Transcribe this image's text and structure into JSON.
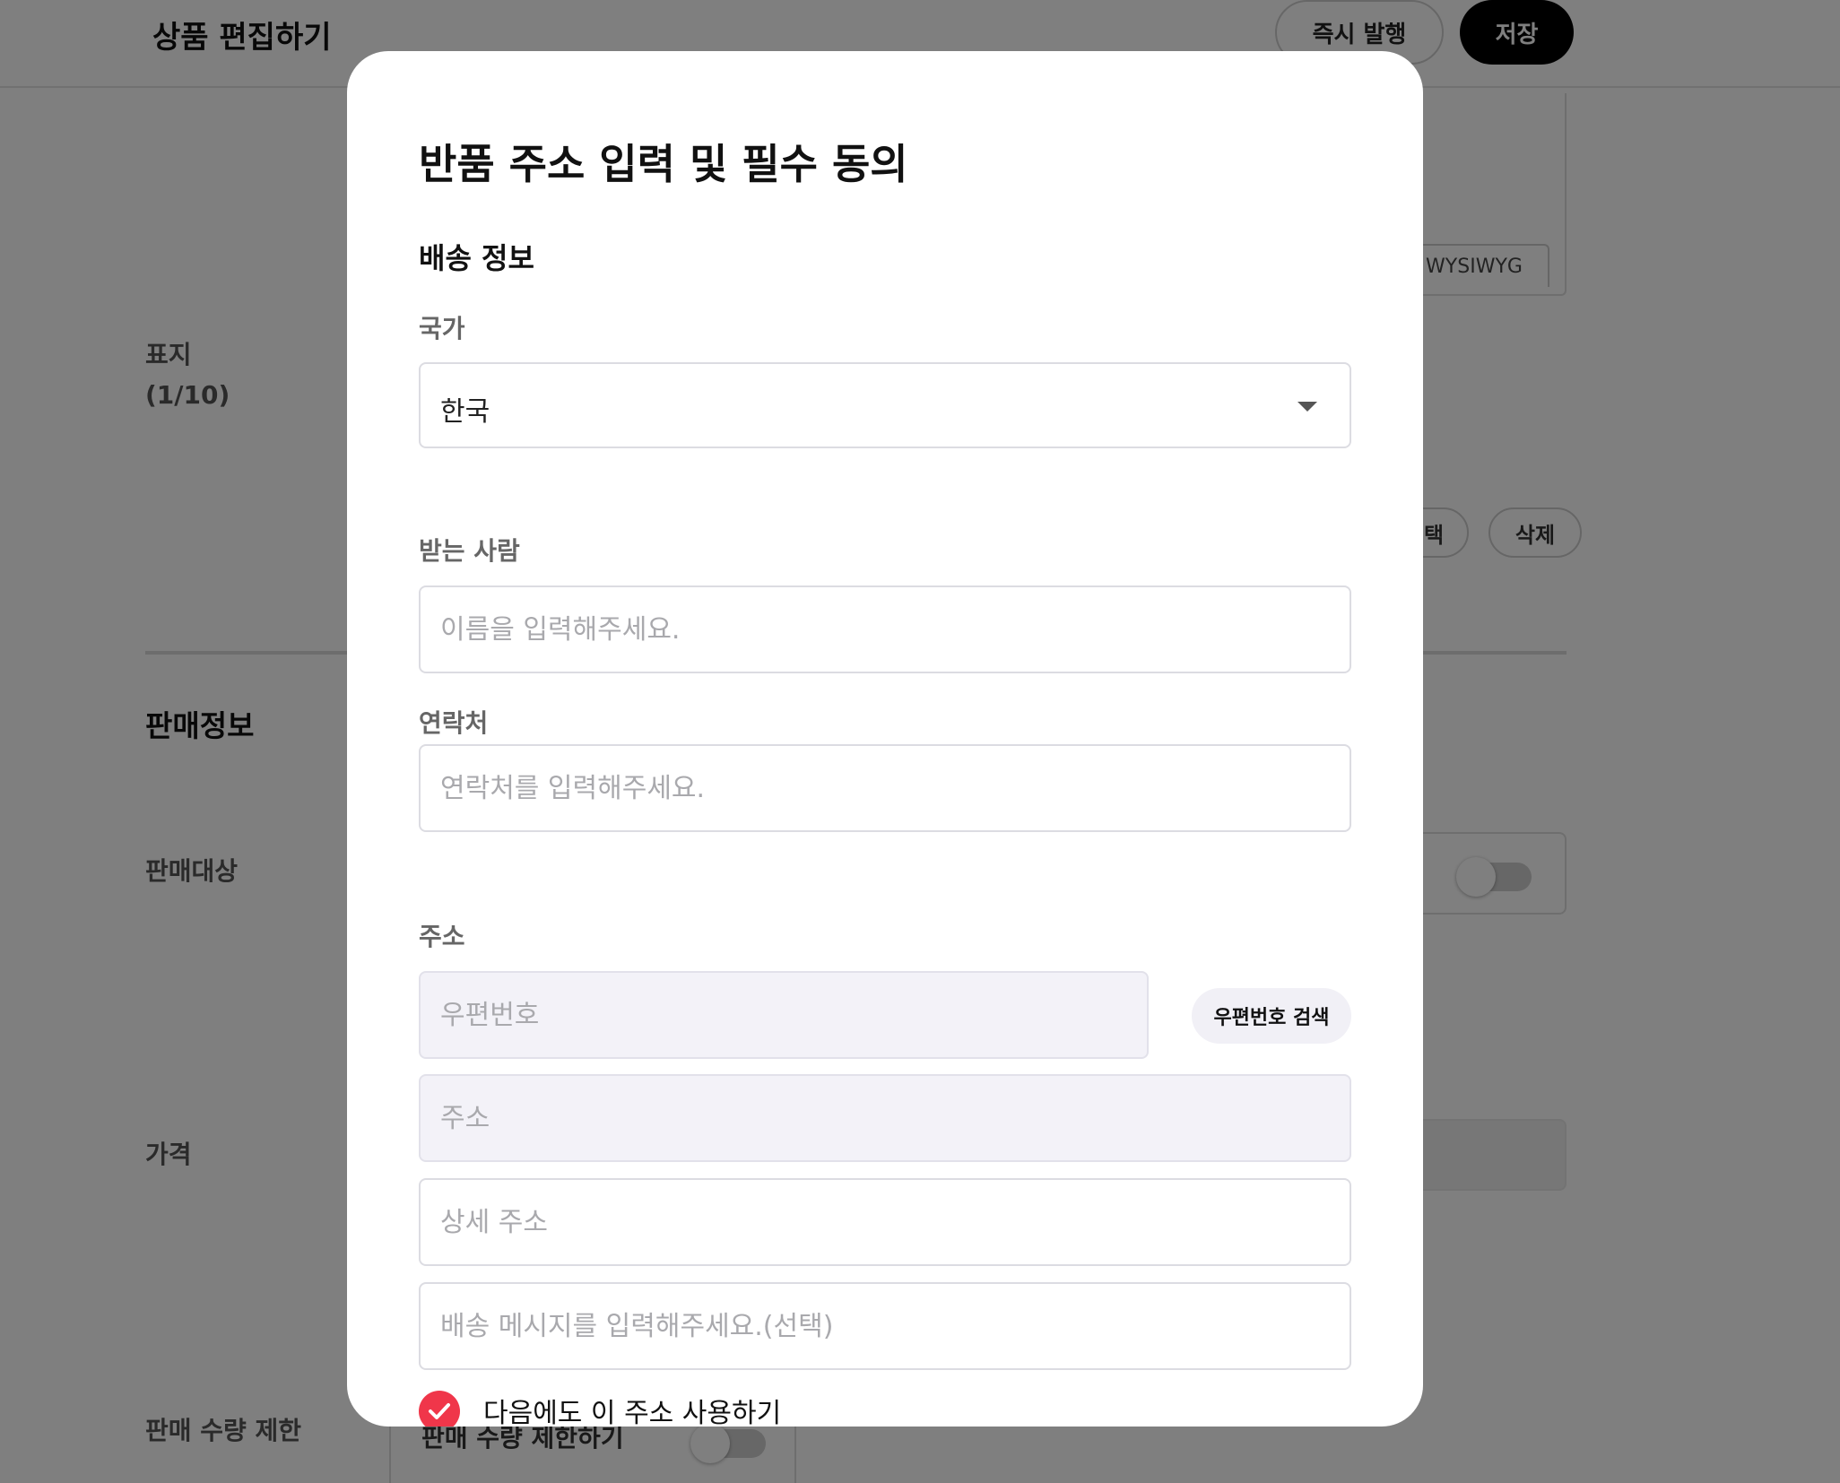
{
  "page": {
    "title": "상품 편집하기",
    "publish_now_label": "즉시 발행",
    "save_label": "저장",
    "editor_tab": "WYSIWYG",
    "cover_label": "표지",
    "cover_count": "(1/10)",
    "cover_select_label": "선택",
    "cover_delete_label": "삭제",
    "sales_section_title": "판매정보",
    "sales_target_label": "판매대상",
    "price_label": "가격",
    "quantity_limit_label": "판매 수량 제한",
    "quantity_limit_toggle_label": "판매 수량 제한하기"
  },
  "modal": {
    "title": "반품 주소 입력 및 필수 동의",
    "section_title": "배송 정보",
    "country": {
      "label": "국가",
      "value": "한국"
    },
    "recipient": {
      "label": "받는 사람",
      "placeholder": "이름을 입력해주세요."
    },
    "phone": {
      "label": "연락처",
      "placeholder": "연락처를 입력해주세요."
    },
    "address": {
      "label": "주소",
      "zip_placeholder": "우편번호",
      "zip_search_label": "우편번호 검색",
      "address_placeholder": "주소",
      "detail_placeholder": "상세 주소",
      "message_placeholder": "배송 메시지를 입력해주세요.(선택)"
    },
    "save_address": {
      "label": "다음에도 이 주소 사용하기",
      "checked": true
    }
  },
  "colors": {
    "accent_red": "#f0364a",
    "primary_black": "#000000",
    "overlay": "rgba(0,0,0,0.5)",
    "readonly_fill": "#f3f2f8"
  }
}
